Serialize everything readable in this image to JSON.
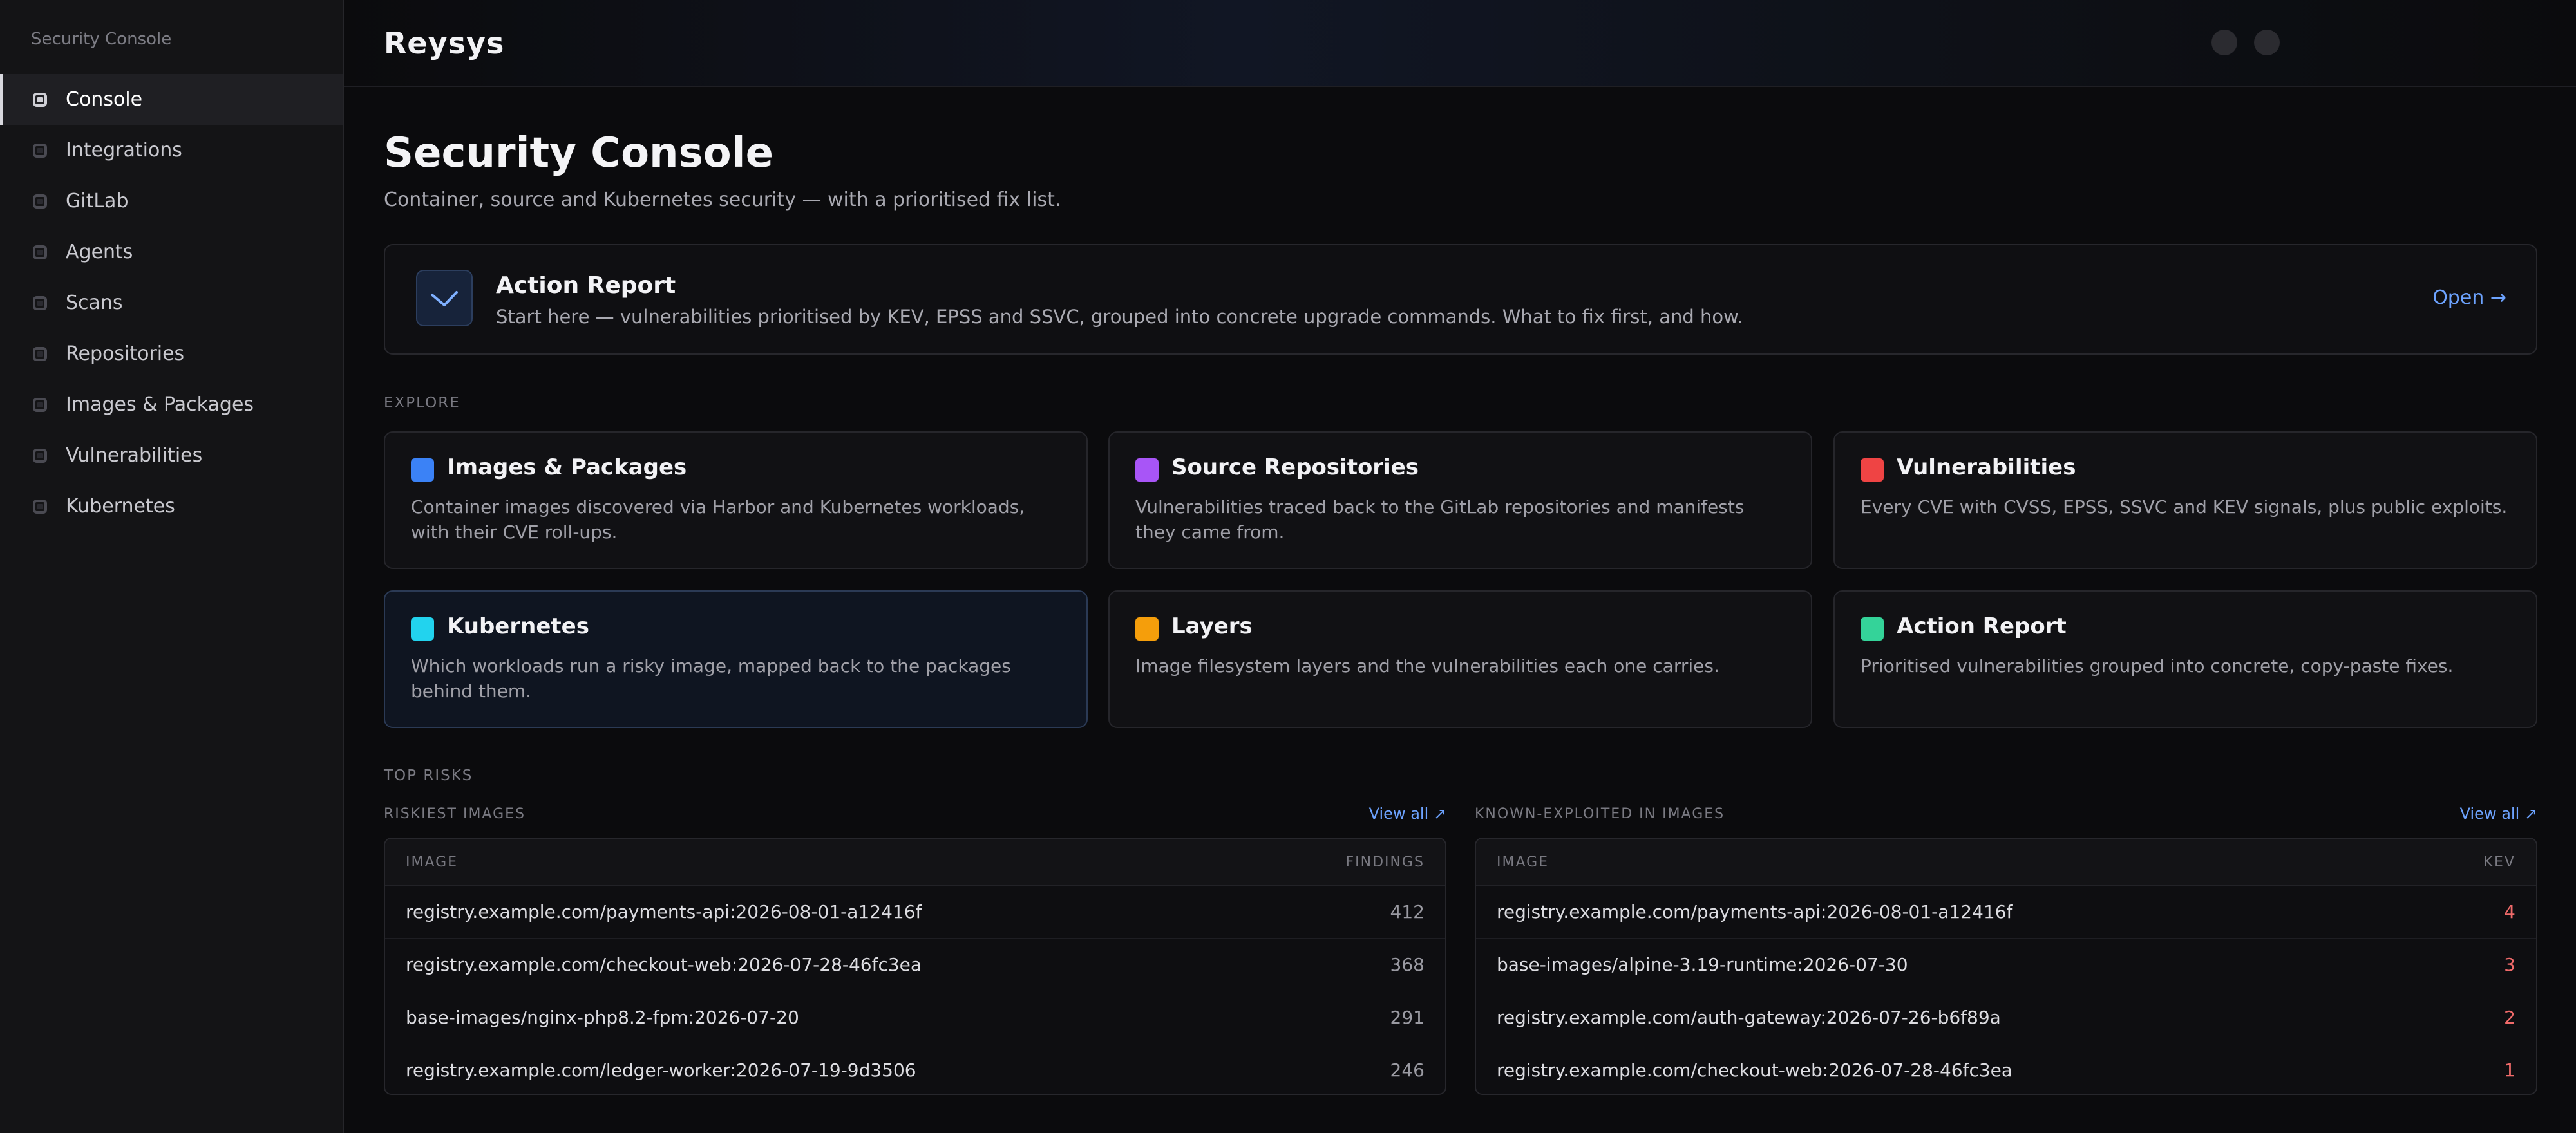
{
  "sidebar": {
    "title": "Security Console",
    "items": [
      {
        "label": "Console"
      },
      {
        "label": "Integrations"
      },
      {
        "label": "GitLab"
      },
      {
        "label": "Agents"
      },
      {
        "label": "Scans"
      },
      {
        "label": "Repositories"
      },
      {
        "label": "Images & Packages"
      },
      {
        "label": "Vulnerabilities"
      },
      {
        "label": "Kubernetes"
      }
    ]
  },
  "header": {
    "brand": "Reysys"
  },
  "page": {
    "title": "Security Console",
    "subtitle": "Container, source and Kubernetes security — with a prioritised fix list."
  },
  "hero": {
    "icon": "check-icon",
    "title": "Action Report",
    "description": "Start here — vulnerabilities prioritised by KEV, EPSS and SSVC, grouped into concrete upgrade commands. What to fix first, and how.",
    "link": "Open →",
    "accent": "#6da3ff"
  },
  "explore": {
    "label": "EXPLORE",
    "cards": [
      {
        "title": "Images & Packages",
        "description": "Container images discovered via Harbor and Kubernetes workloads, with their CVE roll-ups.",
        "color": "#3b82f6"
      },
      {
        "title": "Source Repositories",
        "description": "Vulnerabilities traced back to the GitLab repositories and manifests they came from.",
        "color": "#a855f7"
      },
      {
        "title": "Vulnerabilities",
        "description": "Every CVE with CVSS, EPSS, SSVC and KEV signals, plus public exploits.",
        "color": "#ef4444"
      },
      {
        "title": "Kubernetes",
        "description": "Which workloads run a risky image, mapped back to the packages behind them.",
        "color": "#22d3ee"
      },
      {
        "title": "Layers",
        "description": "Image filesystem layers and the vulnerabilities each one carries.",
        "color": "#f59e0b"
      },
      {
        "title": "Action Report",
        "description": "Prioritised vulnerabilities grouped into concrete, copy-paste fixes.",
        "color": "#34d399"
      }
    ]
  },
  "top_risks": {
    "label": "TOP RISKS",
    "riskiest": {
      "label": "RISKIEST IMAGES",
      "view_all": "View all ↗",
      "columns": [
        "IMAGE",
        "FINDINGS"
      ],
      "rows": [
        {
          "image": "registry.example.com/payments-api:2026-08-01-a12416f",
          "value": "412"
        },
        {
          "image": "registry.example.com/checkout-web:2026-07-28-46fc3ea",
          "value": "368"
        },
        {
          "image": "base-images/nginx-php8.2-fpm:2026-07-20",
          "value": "291"
        },
        {
          "image": "registry.example.com/ledger-worker:2026-07-19-9d3506",
          "value": "246"
        }
      ]
    },
    "kev": {
      "label": "KNOWN-EXPLOITED IN IMAGES",
      "view_all": "View all ↗",
      "columns": [
        "IMAGE",
        "KEV"
      ],
      "rows": [
        {
          "image": "registry.example.com/payments-api:2026-08-01-a12416f",
          "value": "4"
        },
        {
          "image": "base-images/alpine-3.19-runtime:2026-07-30",
          "value": "3"
        },
        {
          "image": "registry.example.com/auth-gateway:2026-07-26-b6f89a",
          "value": "2"
        },
        {
          "image": "registry.example.com/checkout-web:2026-07-28-46fc3ea",
          "value": "1"
        }
      ]
    }
  }
}
